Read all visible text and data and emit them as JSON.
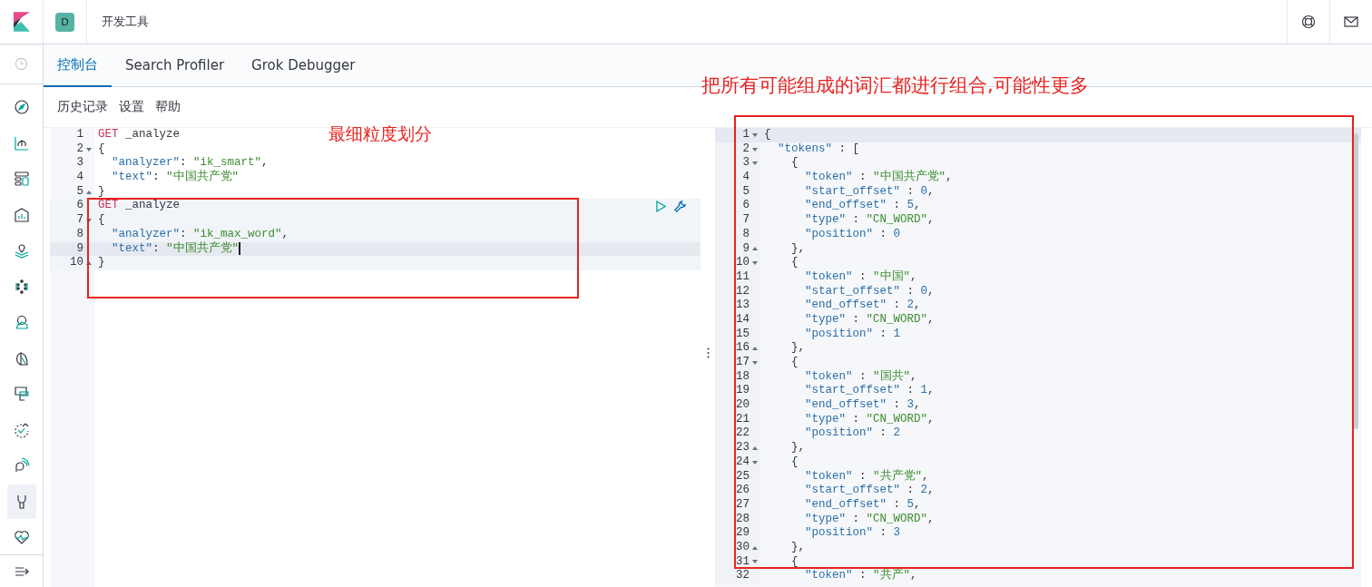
{
  "header": {
    "space_badge": "D",
    "title": "开发工具"
  },
  "sidebar": {
    "items": [
      {
        "kind": "compass",
        "selected": false
      },
      {
        "kind": "chart",
        "selected": false
      },
      {
        "kind": "layout",
        "selected": false
      },
      {
        "kind": "easel",
        "selected": false
      },
      {
        "kind": "pin",
        "selected": false
      },
      {
        "kind": "dots",
        "selected": false
      },
      {
        "kind": "person",
        "selected": false
      },
      {
        "kind": "pie",
        "selected": false
      },
      {
        "kind": "monitor",
        "selected": false
      },
      {
        "kind": "check",
        "selected": false
      },
      {
        "kind": "signal",
        "selected": false
      },
      {
        "kind": "wrench",
        "selected": true
      },
      {
        "kind": "heart",
        "selected": false
      }
    ]
  },
  "tabs": [
    {
      "label": "控制台",
      "selected": true
    },
    {
      "label": "Search Profiler",
      "selected": false
    },
    {
      "label": "Grok Debugger",
      "selected": false
    }
  ],
  "menu": [
    "历史记录",
    "设置",
    "帮助"
  ],
  "request_editor": {
    "lines": [
      {
        "number": "1",
        "code": [
          {
            "kind": "method",
            "text": "GET"
          },
          {
            "kind": "plain",
            "text": " _analyze"
          }
        ]
      },
      {
        "number": "2",
        "fold_open": true,
        "code": [
          {
            "kind": "plain",
            "text": "{"
          }
        ]
      },
      {
        "number": "3",
        "code": [
          {
            "kind": "key",
            "text": "  \"analyzer\""
          },
          {
            "kind": "plain",
            "text": ": "
          },
          {
            "kind": "string",
            "text": "\"ik_smart\""
          },
          {
            "kind": "plain",
            "text": ","
          }
        ]
      },
      {
        "number": "4",
        "code": [
          {
            "kind": "key",
            "text": "  \"text\""
          },
          {
            "kind": "plain",
            "text": ": "
          },
          {
            "kind": "string",
            "text": "\"中国共产党\""
          }
        ]
      },
      {
        "number": "5",
        "fold_close": true,
        "code": [
          {
            "kind": "plain",
            "text": "}"
          }
        ]
      },
      {
        "number": "6",
        "in_request": true,
        "actions": true,
        "code": [
          {
            "kind": "method",
            "text": "GET"
          },
          {
            "kind": "plain",
            "text": " _analyze"
          }
        ]
      },
      {
        "number": "7",
        "in_request": true,
        "fold_open": true,
        "code": [
          {
            "kind": "plain",
            "text": "{"
          }
        ]
      },
      {
        "number": "8",
        "in_request": true,
        "code": [
          {
            "kind": "key",
            "text": "  \"analyzer\""
          },
          {
            "kind": "plain",
            "text": ": "
          },
          {
            "kind": "string",
            "text": "\"ik_max_word\""
          },
          {
            "kind": "plain",
            "text": ","
          }
        ]
      },
      {
        "number": "9",
        "in_request": true,
        "cursor_line": true,
        "code": [
          {
            "kind": "key",
            "text": "  \"text\""
          },
          {
            "kind": "plain",
            "text": ": "
          },
          {
            "kind": "string",
            "text": "\"中国共产党\""
          }
        ]
      },
      {
        "number": "10",
        "in_request": true,
        "fold_close": true,
        "code": [
          {
            "kind": "plain",
            "text": "}"
          }
        ]
      }
    ]
  },
  "response_viewer": {
    "lines": [
      {
        "number": "1",
        "fold_open": true,
        "cursor_line": true,
        "code": [
          {
            "kind": "plain",
            "text": "{"
          }
        ]
      },
      {
        "number": "2",
        "fold_open": true,
        "code": [
          {
            "kind": "key",
            "text": "  \"tokens\""
          },
          {
            "kind": "plain",
            "text": " : ["
          }
        ]
      },
      {
        "number": "3",
        "fold_open": true,
        "code": [
          {
            "kind": "plain",
            "text": "    {"
          }
        ]
      },
      {
        "number": "4",
        "code": [
          {
            "kind": "key",
            "text": "      \"token\""
          },
          {
            "kind": "plain",
            "text": " : "
          },
          {
            "kind": "string",
            "text": "\"中国共产党\""
          },
          {
            "kind": "plain",
            "text": ","
          }
        ]
      },
      {
        "number": "5",
        "code": [
          {
            "kind": "key",
            "text": "      \"start_offset\""
          },
          {
            "kind": "plain",
            "text": " : "
          },
          {
            "kind": "number",
            "text": "0"
          },
          {
            "kind": "plain",
            "text": ","
          }
        ]
      },
      {
        "number": "6",
        "code": [
          {
            "kind": "key",
            "text": "      \"end_offset\""
          },
          {
            "kind": "plain",
            "text": " : "
          },
          {
            "kind": "number",
            "text": "5"
          },
          {
            "kind": "plain",
            "text": ","
          }
        ]
      },
      {
        "number": "7",
        "code": [
          {
            "kind": "key",
            "text": "      \"type\""
          },
          {
            "kind": "plain",
            "text": " : "
          },
          {
            "kind": "string",
            "text": "\"CN_WORD\""
          },
          {
            "kind": "plain",
            "text": ","
          }
        ]
      },
      {
        "number": "8",
        "code": [
          {
            "kind": "key",
            "text": "      \"position\""
          },
          {
            "kind": "plain",
            "text": " : "
          },
          {
            "kind": "number",
            "text": "0"
          }
        ]
      },
      {
        "number": "9",
        "fold_close": true,
        "code": [
          {
            "kind": "plain",
            "text": "    },"
          }
        ]
      },
      {
        "number": "10",
        "fold_open": true,
        "code": [
          {
            "kind": "plain",
            "text": "    {"
          }
        ]
      },
      {
        "number": "11",
        "code": [
          {
            "kind": "key",
            "text": "      \"token\""
          },
          {
            "kind": "plain",
            "text": " : "
          },
          {
            "kind": "string",
            "text": "\"中国\""
          },
          {
            "kind": "plain",
            "text": ","
          }
        ]
      },
      {
        "number": "12",
        "code": [
          {
            "kind": "key",
            "text": "      \"start_offset\""
          },
          {
            "kind": "plain",
            "text": " : "
          },
          {
            "kind": "number",
            "text": "0"
          },
          {
            "kind": "plain",
            "text": ","
          }
        ]
      },
      {
        "number": "13",
        "code": [
          {
            "kind": "key",
            "text": "      \"end_offset\""
          },
          {
            "kind": "plain",
            "text": " : "
          },
          {
            "kind": "number",
            "text": "2"
          },
          {
            "kind": "plain",
            "text": ","
          }
        ]
      },
      {
        "number": "14",
        "code": [
          {
            "kind": "key",
            "text": "      \"type\""
          },
          {
            "kind": "plain",
            "text": " : "
          },
          {
            "kind": "string",
            "text": "\"CN_WORD\""
          },
          {
            "kind": "plain",
            "text": ","
          }
        ]
      },
      {
        "number": "15",
        "code": [
          {
            "kind": "key",
            "text": "      \"position\""
          },
          {
            "kind": "plain",
            "text": " : "
          },
          {
            "kind": "number",
            "text": "1"
          }
        ]
      },
      {
        "number": "16",
        "fold_close": true,
        "code": [
          {
            "kind": "plain",
            "text": "    },"
          }
        ]
      },
      {
        "number": "17",
        "fold_open": true,
        "code": [
          {
            "kind": "plain",
            "text": "    {"
          }
        ]
      },
      {
        "number": "18",
        "code": [
          {
            "kind": "key",
            "text": "      \"token\""
          },
          {
            "kind": "plain",
            "text": " : "
          },
          {
            "kind": "string",
            "text": "\"国共\""
          },
          {
            "kind": "plain",
            "text": ","
          }
        ]
      },
      {
        "number": "19",
        "code": [
          {
            "kind": "key",
            "text": "      \"start_offset\""
          },
          {
            "kind": "plain",
            "text": " : "
          },
          {
            "kind": "number",
            "text": "1"
          },
          {
            "kind": "plain",
            "text": ","
          }
        ]
      },
      {
        "number": "20",
        "code": [
          {
            "kind": "key",
            "text": "      \"end_offset\""
          },
          {
            "kind": "plain",
            "text": " : "
          },
          {
            "kind": "number",
            "text": "3"
          },
          {
            "kind": "plain",
            "text": ","
          }
        ]
      },
      {
        "number": "21",
        "code": [
          {
            "kind": "key",
            "text": "      \"type\""
          },
          {
            "kind": "plain",
            "text": " : "
          },
          {
            "kind": "string",
            "text": "\"CN_WORD\""
          },
          {
            "kind": "plain",
            "text": ","
          }
        ]
      },
      {
        "number": "22",
        "code": [
          {
            "kind": "key",
            "text": "      \"position\""
          },
          {
            "kind": "plain",
            "text": " : "
          },
          {
            "kind": "number",
            "text": "2"
          }
        ]
      },
      {
        "number": "23",
        "fold_close": true,
        "code": [
          {
            "kind": "plain",
            "text": "    },"
          }
        ]
      },
      {
        "number": "24",
        "fold_open": true,
        "code": [
          {
            "kind": "plain",
            "text": "    {"
          }
        ]
      },
      {
        "number": "25",
        "code": [
          {
            "kind": "key",
            "text": "      \"token\""
          },
          {
            "kind": "plain",
            "text": " : "
          },
          {
            "kind": "string",
            "text": "\"共产党\""
          },
          {
            "kind": "plain",
            "text": ","
          }
        ]
      },
      {
        "number": "26",
        "code": [
          {
            "kind": "key",
            "text": "      \"start_offset\""
          },
          {
            "kind": "plain",
            "text": " : "
          },
          {
            "kind": "number",
            "text": "2"
          },
          {
            "kind": "plain",
            "text": ","
          }
        ]
      },
      {
        "number": "27",
        "code": [
          {
            "kind": "key",
            "text": "      \"end_offset\""
          },
          {
            "kind": "plain",
            "text": " : "
          },
          {
            "kind": "number",
            "text": "5"
          },
          {
            "kind": "plain",
            "text": ","
          }
        ]
      },
      {
        "number": "28",
        "code": [
          {
            "kind": "key",
            "text": "      \"type\""
          },
          {
            "kind": "plain",
            "text": " : "
          },
          {
            "kind": "string",
            "text": "\"CN_WORD\""
          },
          {
            "kind": "plain",
            "text": ","
          }
        ]
      },
      {
        "number": "29",
        "code": [
          {
            "kind": "key",
            "text": "      \"position\""
          },
          {
            "kind": "plain",
            "text": " : "
          },
          {
            "kind": "number",
            "text": "3"
          }
        ]
      },
      {
        "number": "30",
        "fold_close": true,
        "code": [
          {
            "kind": "plain",
            "text": "    },"
          }
        ]
      },
      {
        "number": "31",
        "fold_open": true,
        "code": [
          {
            "kind": "plain",
            "text": "    {"
          }
        ]
      },
      {
        "number": "32",
        "code": [
          {
            "kind": "key",
            "text": "      \"token\""
          },
          {
            "kind": "plain",
            "text": " : "
          },
          {
            "kind": "string",
            "text": "\"共产\""
          },
          {
            "kind": "plain",
            "text": ","
          }
        ]
      }
    ]
  },
  "annotations": {
    "left_label": "最细粒度划分",
    "right_label": "把所有可能组成的词汇都进行组合,可能性更多"
  }
}
